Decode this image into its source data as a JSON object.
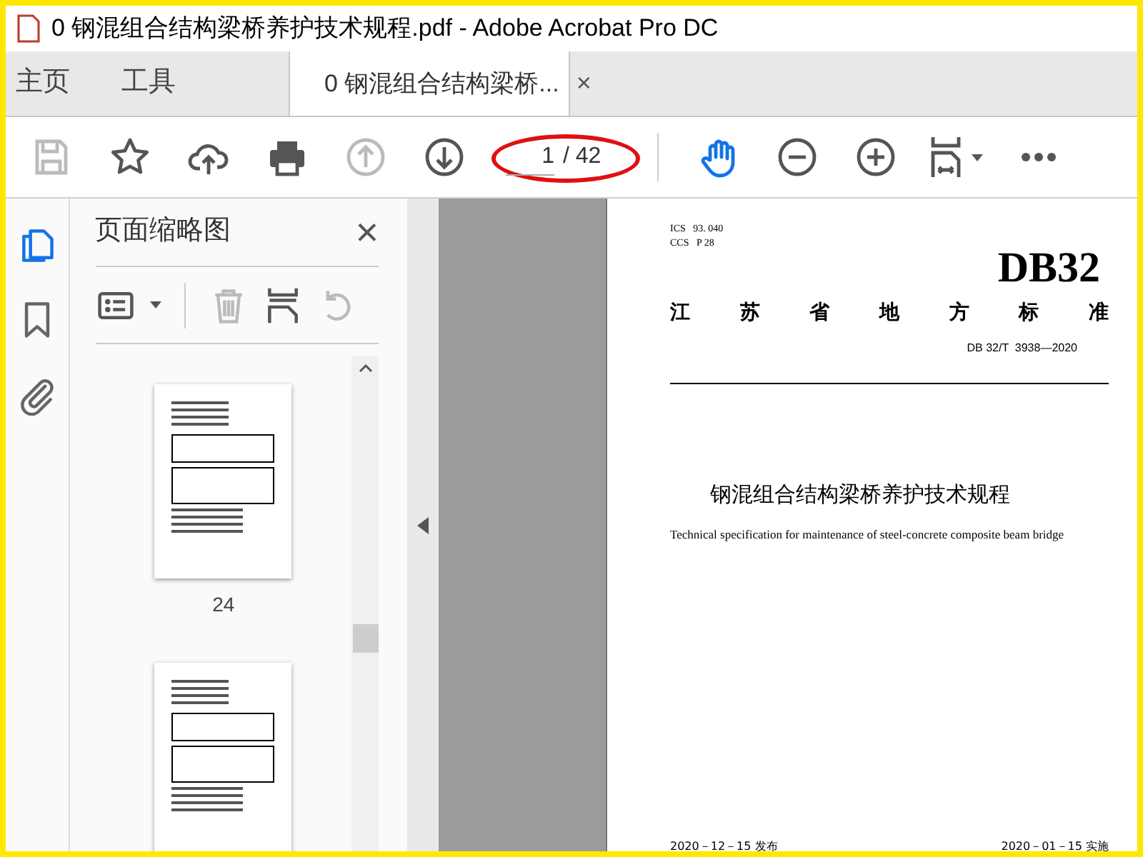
{
  "window": {
    "title": "0 钢混组合结构梁桥养护技术规程.pdf - Adobe Acrobat Pro DC"
  },
  "tabs": [
    {
      "label": "主页",
      "selected": false
    },
    {
      "label": "工具",
      "selected": false
    },
    {
      "label": "0 钢混组合结构梁桥...",
      "selected": true,
      "close": "×"
    }
  ],
  "toolbar": {
    "page_current": "1",
    "page_total": "/ 42",
    "hand_tool": {
      "selected": true
    }
  },
  "side_rail": [
    {
      "kind": "pages",
      "selected": true
    },
    {
      "kind": "bookmarks",
      "selected": false
    },
    {
      "kind": "attachments",
      "selected": false
    }
  ],
  "thumbnail_panel": {
    "title": "页面缩略图",
    "close": "×",
    "thumbnails": [
      {
        "label": "24",
        "selected": false
      },
      {
        "selected": false
      }
    ]
  },
  "document": {
    "ics": "ICS   93. 040",
    "ccs": "CCS   P 28",
    "code": "DB32",
    "province_chars": [
      "江",
      "苏",
      "省",
      "地",
      "方",
      "标",
      "准"
    ],
    "standard_no": "DB 32/T  3938—2020",
    "title_cn": "钢混组合结构梁桥养护技术规程",
    "title_en": "Technical specification for maintenance of steel-concrete composite beam bridge",
    "issued": "2020－12－15 发布",
    "implemented": "2020－01－15 实施"
  }
}
